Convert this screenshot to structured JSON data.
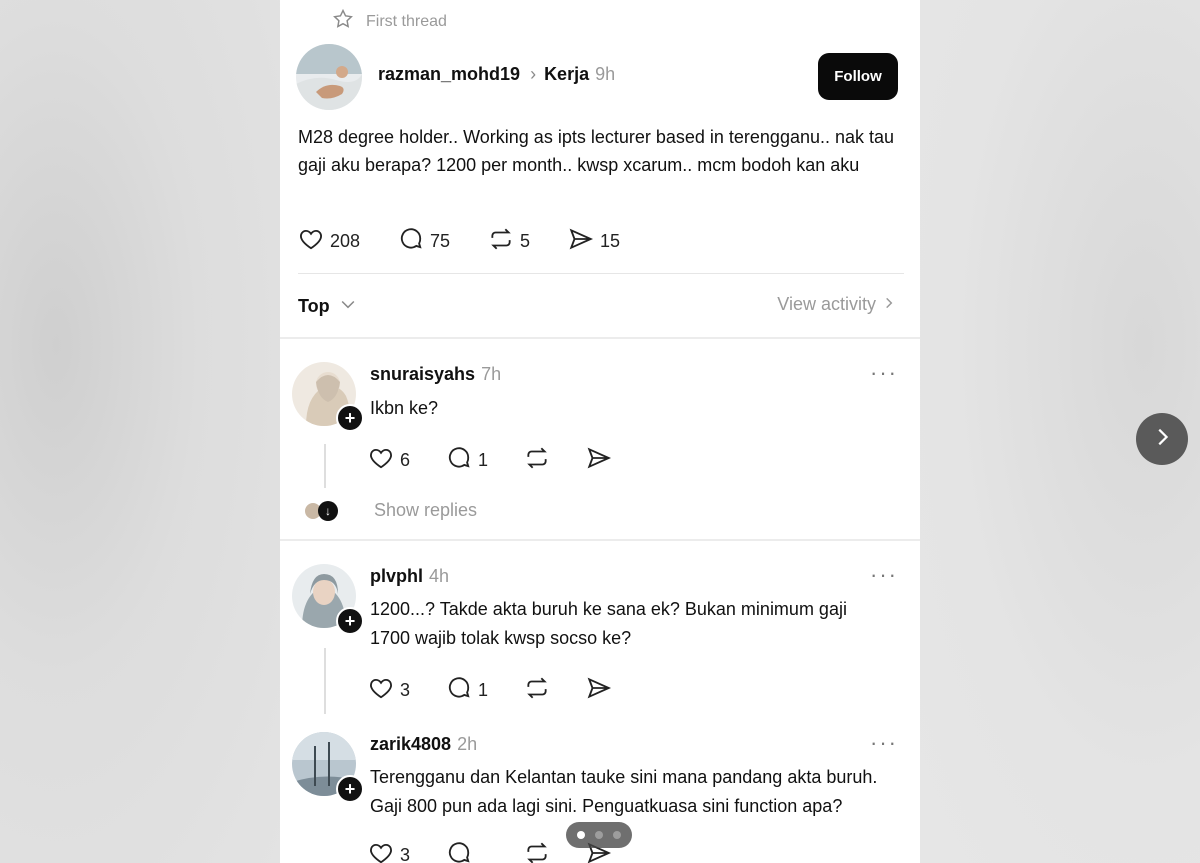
{
  "thread_label": "First thread",
  "post": {
    "username": "razman_mohd19",
    "topic": "Kerja",
    "time": "9h",
    "follow_label": "Follow",
    "text": "M28 degree holder.. Working as ipts lecturer based in terengganu.. nak tau gaji aku berapa? 1200 per month.. kwsp xcarum.. mcm bodoh kan aku",
    "likes": "208",
    "replies": "75",
    "reposts": "5",
    "shares": "15"
  },
  "sort": {
    "label": "Top",
    "view_activity": "View activity"
  },
  "replies": [
    {
      "username": "snuraisyahs",
      "time": "7h",
      "text": "Ikbn ke?",
      "likes": "6",
      "replies": "1"
    },
    {
      "username": "plvphl",
      "time": "4h",
      "text": "1200...? Takde akta buruh ke sana ek? Bukan minimum gaji 1700 wajib tolak kwsp socso ke?",
      "likes": "3",
      "replies": "1"
    },
    {
      "username": "zarik4808",
      "time": "2h",
      "text": "Terengganu dan Kelantan tauke sini mana pandang akta buruh. Gaji 800 pun ada lagi sini. Penguatkuasa sini function apa?",
      "likes": "3"
    }
  ],
  "show_replies_label": "Show replies",
  "pager": {
    "total": 3,
    "active": 1
  },
  "icons": {
    "star": "star-icon",
    "heart": "heart-icon",
    "comment": "comment-icon",
    "repost": "repost-icon",
    "share": "share-icon",
    "next": "chevron-right-icon"
  }
}
